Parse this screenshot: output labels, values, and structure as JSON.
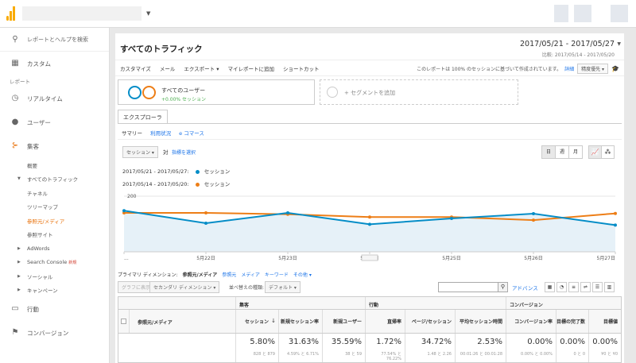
{
  "sidebar": {
    "search_placeholder": "レポートとヘルプを検索",
    "custom": "カスタム",
    "reports_label": "レポート",
    "realtime": "リアルタイム",
    "audience": "ユーザー",
    "acquisition": "集客",
    "overview": "概要",
    "all_traffic": "すべてのトラフィック",
    "channels": "チャネル",
    "treemap": "ツリーマップ",
    "source_medium": "参照元/メディア",
    "referrals": "参照サイト",
    "adwords": "AdWords",
    "search_console": "Search Console",
    "new_badge": "新規",
    "social": "ソーシャル",
    "campaigns": "キャンペーン",
    "behavior": "行動",
    "conversions": "コンバージョン"
  },
  "header": {
    "title": "すべてのトラフィック",
    "date_range": "2017/05/21 - 2017/05/27",
    "compare_range": "比較: 2017/05/14 - 2017/05/20"
  },
  "toolbar": {
    "customize": "カスタマイズ",
    "email": "メール",
    "export": "エクスポート",
    "add_dashboard": "マイレポートに追加",
    "shortcut": "ショートカット",
    "sampling_note": "このレポートは 100% のセッションに基づいて作成されています。",
    "details": "詳細",
    "precision": "精度優先"
  },
  "segments": {
    "name": "すべてのユーザー",
    "pct": "+0.00% セッション",
    "add": "+ セグメントを追加"
  },
  "explorer": {
    "tab": "エクスプローラ",
    "summary": "サマリー",
    "usage": "利用状況",
    "ecommerce": "e コマース",
    "metric": "セッション",
    "vs": "対",
    "select_metric": "指標を選択",
    "period_day": "日",
    "period_week": "週",
    "period_month": "月"
  },
  "legend": [
    {
      "range": "2017/05/21 - 2017/05/27:",
      "label": "セッション",
      "color": "#058dc7"
    },
    {
      "range": "2017/05/14 - 2017/05/20:",
      "label": "セッション",
      "color": "#ed7e17"
    }
  ],
  "chart_data": {
    "type": "line",
    "y_ticks": [
      "200",
      "100"
    ],
    "ylim": [
      0,
      200
    ],
    "x_labels": [
      "...",
      "5月22日",
      "5月23日",
      "5月24日",
      "5月25日",
      "5月26日",
      "5月27日"
    ],
    "series": [
      {
        "name": "2017/05/21 - 2017/05/27",
        "color": "#058dc7",
        "values": [
          148,
          103,
          140,
          99,
          120,
          137,
          96
        ]
      },
      {
        "name": "2017/05/14 - 2017/05/20",
        "color": "#ed7e17",
        "values": [
          140,
          140,
          135,
          125,
          125,
          114,
          138
        ]
      }
    ]
  },
  "primary_dimension": {
    "label": "プライマリ ディメンション:",
    "current": "参照元/メディア",
    "source": "参照元",
    "medium": "メディア",
    "keyword": "キーワード",
    "other": "その他"
  },
  "table_tools": {
    "plot_rows": "グラフに表示",
    "secondary_dim": "セカンダリ ディメンション",
    "sort_type": "並べ替えの種類:",
    "default": "デフォルト",
    "advanced": "アドバンス"
  },
  "table": {
    "groups": {
      "acq": "集客",
      "beh": "行動",
      "conv": "コンバージョン"
    },
    "dim_header": "参照元/メディア",
    "columns": [
      {
        "name": "セッション",
        "value": "5.80%",
        "sub": "828 と 879"
      },
      {
        "name": "新規セッション率",
        "value": "31.63%",
        "sub": "4.59% と 6.71%"
      },
      {
        "name": "新規ユーザー",
        "value": "35.59%",
        "sub": "38 と 59"
      },
      {
        "name": "直帰率",
        "value": "1.72%",
        "sub": "77.54% と 76.22%"
      },
      {
        "name": "ページ/セッション",
        "value": "34.72%",
        "sub": "1.48 と 2.26"
      },
      {
        "name": "平均セッション時間",
        "value": "2.53%",
        "sub": "00:01:26 と 00:01:28"
      },
      {
        "name": "コンバージョン率",
        "value": "0.00%",
        "sub": "0.00% と 0.00%"
      },
      {
        "name": "目標の完了数",
        "value": "0.00%",
        "sub": "0 と 0"
      },
      {
        "name": "目標値",
        "value": "0.00%",
        "sub": "¥0 と ¥0"
      }
    ]
  }
}
